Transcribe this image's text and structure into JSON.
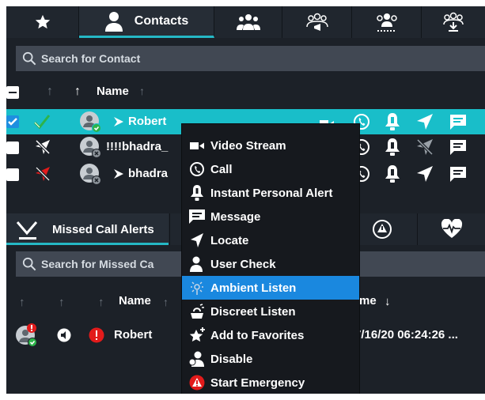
{
  "tabs": [
    {
      "name": "favorites",
      "icon": "star-icon"
    },
    {
      "name": "contacts",
      "label": "Contacts",
      "icon": "person-icon",
      "active": true
    },
    {
      "name": "groups",
      "icon": "group-icon"
    },
    {
      "name": "talkgroup-announce",
      "icon": "group-announce-icon"
    },
    {
      "name": "group-presence",
      "icon": "group-presence-icon"
    },
    {
      "name": "group-download",
      "icon": "group-download-icon"
    }
  ],
  "contacts_search": {
    "placeholder": "Search for Contact"
  },
  "contacts_header": {
    "name_label": "Name"
  },
  "contacts": [
    {
      "name": "Robert",
      "selected": true,
      "status": "online",
      "location": "enabled"
    },
    {
      "name": "!!!!bhadra_",
      "selected": false,
      "status": "offline",
      "location": "disabled"
    },
    {
      "name": "bhadra",
      "selected": false,
      "status": "offline",
      "location": "red"
    }
  ],
  "context_menu": {
    "items": [
      {
        "label": "Video Stream",
        "icon": "video-camera-icon"
      },
      {
        "label": "Call",
        "icon": "phone-call-icon"
      },
      {
        "label": "Instant Personal Alert",
        "icon": "bell-icon"
      },
      {
        "label": "Message",
        "icon": "message-icon"
      },
      {
        "label": "Locate",
        "icon": "locate-arrow-icon"
      },
      {
        "label": "User Check",
        "icon": "user-check-icon"
      },
      {
        "label": "Ambient Listen",
        "icon": "ambient-listen-icon",
        "highlighted": true
      },
      {
        "label": "Discreet Listen",
        "icon": "discreet-listen-icon"
      },
      {
        "label": "Add to Favorites",
        "icon": "add-favorite-icon"
      },
      {
        "label": "Disable",
        "icon": "disable-user-icon"
      },
      {
        "label": "Start Emergency",
        "icon": "emergency-icon"
      }
    ]
  },
  "bottom_tabs": {
    "missed_call_label": "Missed Call Alerts"
  },
  "missed_search": {
    "placeholder": "Search for Missed Ca"
  },
  "missed_header": {
    "name_label": "Name",
    "time_label": "me"
  },
  "missed_calls": [
    {
      "name": "Robert",
      "time": "7/16/20 06:24:26 ..."
    }
  ],
  "colors": {
    "accent": "#19bec9",
    "highlight": "#1a88df",
    "danger": "#e21b1b",
    "ok": "#2db34a"
  }
}
